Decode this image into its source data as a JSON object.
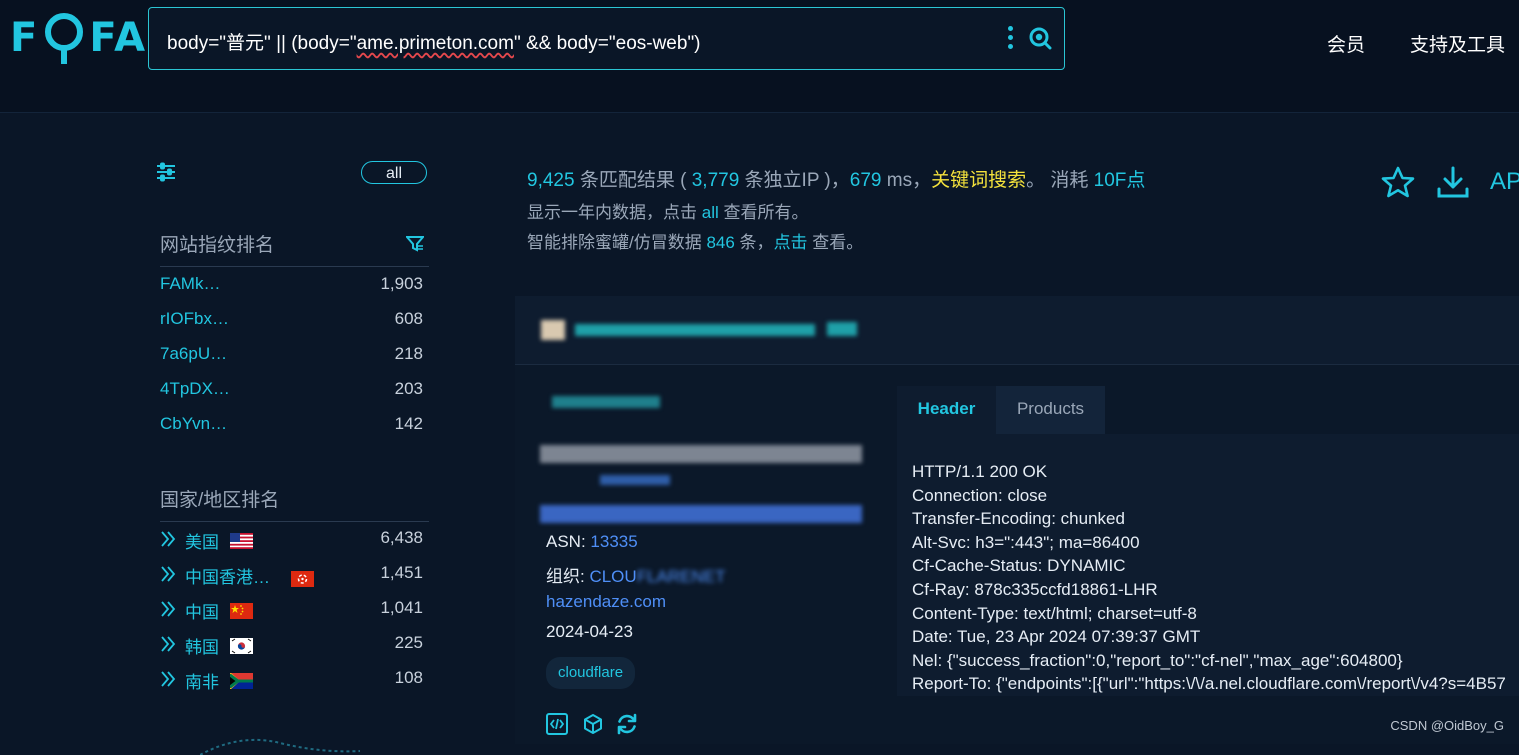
{
  "app": {
    "logo_text_left": "F",
    "logo_text_right": "FA"
  },
  "search": {
    "query_prefix": "body=\"普元\" || (body=\"",
    "query_squiggle": "ame.primeton.com",
    "query_suffix": "\" && body=\"eos-web\")"
  },
  "nav": {
    "member": "会员",
    "tools": "支持及工具"
  },
  "sidebar": {
    "all_label": "all",
    "fingerprint_title": "网站指纹排名",
    "fingerprints": [
      {
        "name": "FAMk…",
        "count": "1,903"
      },
      {
        "name": "rIOFbx…",
        "count": "608"
      },
      {
        "name": "7a6pU…",
        "count": "218"
      },
      {
        "name": "4TpDX…",
        "count": "203"
      },
      {
        "name": "CbYvn…",
        "count": "142"
      }
    ],
    "country_title": "国家/地区排名",
    "countries": [
      {
        "name": "美国",
        "count": "6,438",
        "flag": "us"
      },
      {
        "name": "中国香港…",
        "count": "1,451",
        "flag": "hk"
      },
      {
        "name": "中国",
        "count": "1,041",
        "flag": "cn"
      },
      {
        "name": "韩国",
        "count": "225",
        "flag": "kr"
      },
      {
        "name": "南非",
        "count": "108",
        "flag": "za"
      }
    ]
  },
  "summary": {
    "match_count": "9,425",
    "match_label": " 条匹配结果 ( ",
    "ip_count": "3,779",
    "ip_label": " 条独立IP )，",
    "ms_value": "679",
    "ms_unit": " ms，",
    "keyword_search": "关键词搜索",
    "period": "。 消耗 ",
    "points": "10F点",
    "line2_prefix": "显示一年内数据，点击 ",
    "line2_link": "all",
    "line2_suffix": " 查看所有。",
    "line3_prefix": "智能排除蜜罐/仿冒数据 ",
    "line3_count": "846",
    "line3_mid": " 条，",
    "line3_link": "点击",
    "line3_suffix": " 查看。"
  },
  "actions": {
    "api_label": "AP"
  },
  "result": {
    "asn_label": "ASN: ",
    "asn_value": "13335",
    "org_label": "组织: ",
    "org_value_a": "CLOU",
    "org_value_b": "FLARENET",
    "domain": "hazendaze.com",
    "date": "2024-04-23",
    "tag": "cloudflare",
    "tabs": {
      "header": "Header",
      "products": "Products"
    },
    "header_lines": [
      "HTTP/1.1 200 OK",
      "Connection: close",
      "Transfer-Encoding: chunked",
      "Alt-Svc: h3=\":443\"; ma=86400",
      "Cf-Cache-Status: DYNAMIC",
      "Cf-Ray: 878c335ccfd18861-LHR",
      "Content-Type: text/html; charset=utf-8",
      "Date: Tue, 23 Apr 2024 07:39:37 GMT",
      "Nel: {\"success_fraction\":0,\"report_to\":\"cf-nel\",\"max_age\":604800}",
      "Report-To: {\"endpoints\":[{\"url\":\"https:\\/\\/a.nel.cloudflare.com\\/report\\/v4?s=4B57"
    ]
  },
  "watermark": "CSDN @OidBoy_G",
  "colors": {
    "accent": "#22c6e0",
    "link_blue": "#4f8ff7",
    "highlight_yellow": "#f4e23c",
    "background": "#0a1627"
  }
}
